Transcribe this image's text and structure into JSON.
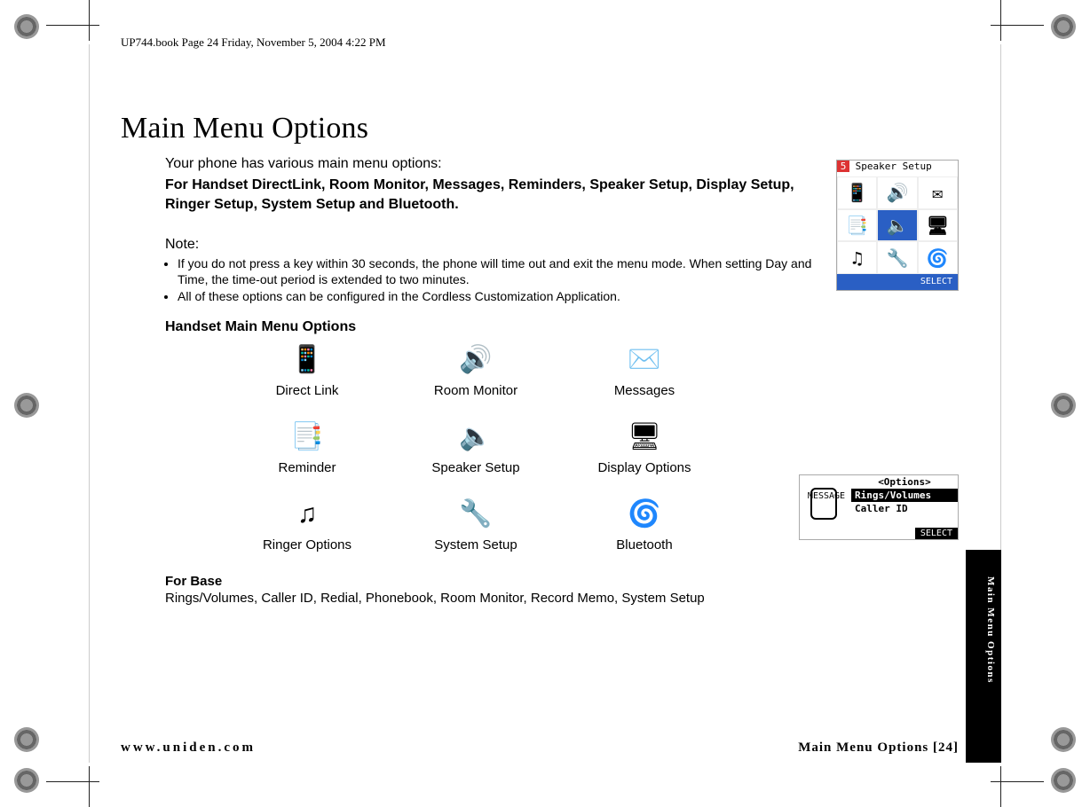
{
  "book_header": "UP744.book  Page 24  Friday, November 5, 2004  4:22 PM",
  "title": "Main Menu Options",
  "intro_line1": "Your phone has various main menu options:",
  "intro_line2": "For Handset DirectLink, Room Monitor, Messages, Reminders, Speaker Setup, Display Setup, Ringer Setup, System Setup and Bluetooth.",
  "note_label": "Note:",
  "notes": [
    "If you do not press a key within 30 seconds, the phone will time out and exit the menu mode. When setting Day and Time, the time-out period is extended to two minutes.",
    "All of these options can be configured in the Cordless Customization Application."
  ],
  "handset_h": "Handset Main Menu Options",
  "icons": [
    {
      "label": "Direct Link",
      "glyph": "📱"
    },
    {
      "label": "Room Monitor",
      "glyph": "🔊"
    },
    {
      "label": "Messages",
      "glyph": "✉️"
    },
    {
      "label": "Reminder",
      "glyph": "📑"
    },
    {
      "label": "Speaker Setup",
      "glyph": "🔈"
    },
    {
      "label": "Display Options",
      "glyph": "🖥"
    },
    {
      "label": "Ringer Options",
      "glyph": "♫"
    },
    {
      "label": "System Setup",
      "glyph": "🔧"
    },
    {
      "label": "Bluetooth",
      "glyph": "🌀"
    }
  ],
  "for_base_h": "For Base",
  "for_base_p": "Rings/Volumes, Caller ID, Redial, Phonebook, Room Monitor, Record Memo, System Setup",
  "footer_left": "www.uniden.com",
  "footer_right": "Main Menu Options [24]",
  "side_tab": "Main Menu Options",
  "lcd1": {
    "num": "5",
    "header": "Speaker Setup",
    "select": "SELECT",
    "cells": [
      "📱",
      "🔊",
      "✉",
      "📑",
      "🔈",
      "🖥",
      "♫",
      "🔧",
      "🌀"
    ],
    "selected_index": 4
  },
  "lcd2": {
    "msg_label": "MESSAGE",
    "title": "<Options>",
    "row_hl": "Rings/Volumes",
    "row2": "Caller ID",
    "select": "SELECT"
  }
}
